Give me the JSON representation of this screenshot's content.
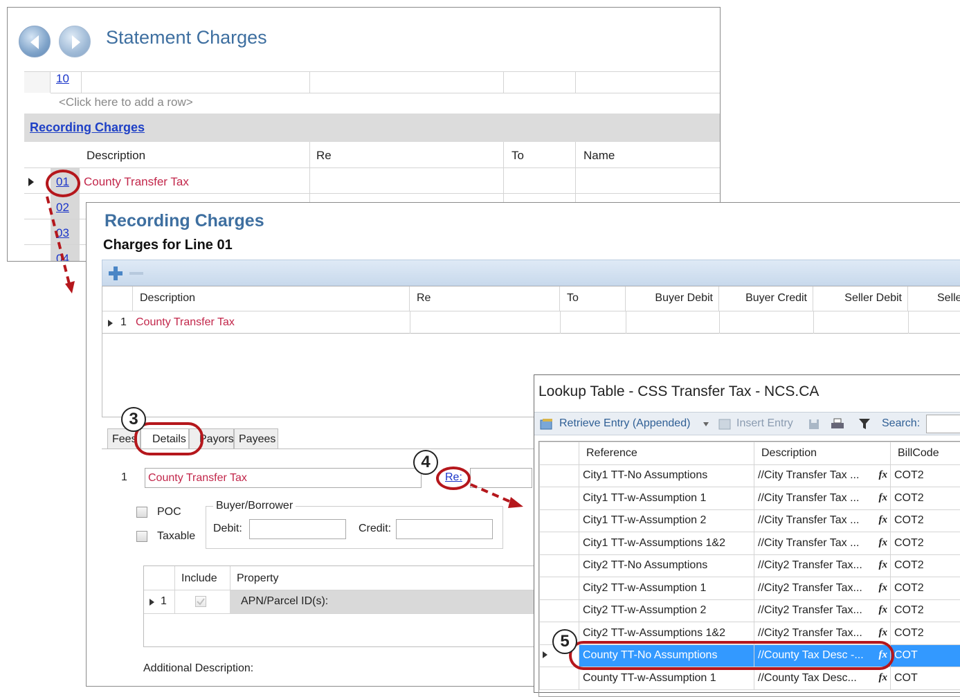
{
  "window1": {
    "title": "Statement Charges",
    "row_10": "10",
    "add_row": "<Click here to add a row>",
    "section_link": "Recording Charges",
    "headers": [
      "Description",
      "Re",
      "To",
      "Name"
    ],
    "rows": [
      {
        "num": "01",
        "desc": "County Transfer Tax"
      },
      {
        "num": "02",
        "desc": ""
      },
      {
        "num": "03",
        "desc": ""
      },
      {
        "num": "04",
        "desc": ""
      }
    ]
  },
  "window2": {
    "title": "Recording Charges",
    "subtitle": "Charges for Line 01",
    "headers": [
      "Description",
      "Re",
      "To",
      "Buyer Debit",
      "Buyer Credit",
      "Seller Debit",
      "Selle"
    ],
    "row": {
      "num": "1",
      "desc": "County Transfer Tax"
    },
    "tabs": [
      "Fees",
      "Details",
      "Payors",
      "Payees"
    ],
    "details": {
      "line_num": "1",
      "description": "County Transfer Tax",
      "re_link": "Re:",
      "poc_label": "POC",
      "taxable_label": "Taxable",
      "group_label": "Buyer/Borrower",
      "debit_label": "Debit:",
      "credit_label": "Credit:",
      "prop_headers": [
        "Include",
        "Property"
      ],
      "prop_row": {
        "num": "1",
        "property": "APN/Parcel ID(s):"
      },
      "additional_label": "Additional Description:"
    }
  },
  "window3": {
    "title": "Lookup Table - CSS Transfer Tax - NCS.CA",
    "toolbar": {
      "retrieve": "Retrieve Entry (Appended)",
      "insert": "Insert Entry",
      "search": "Search:"
    },
    "headers": [
      "Reference",
      "Description",
      "BillCode"
    ],
    "rows": [
      {
        "ref": "City1 TT-No Assumptions",
        "desc": "//City Transfer Tax ...",
        "code": "COT2"
      },
      {
        "ref": "City1 TT-w-Assumption 1",
        "desc": "//City Transfer Tax ...",
        "code": "COT2"
      },
      {
        "ref": "City1 TT-w-Assumption 2",
        "desc": "//City Transfer Tax ...",
        "code": "COT2"
      },
      {
        "ref": "City1 TT-w-Assumptions 1&2",
        "desc": "//City Transfer Tax ...",
        "code": "COT2"
      },
      {
        "ref": "City2 TT-No Assumptions",
        "desc": "//City2 Transfer Tax...",
        "code": "COT2"
      },
      {
        "ref": "City2 TT-w-Assumption 1",
        "desc": "//City2 Transfer Tax...",
        "code": "COT2"
      },
      {
        "ref": "City2 TT-w-Assumption 2",
        "desc": "//City2 Transfer Tax...",
        "code": "COT2"
      },
      {
        "ref": "City2 TT-w-Assumptions 1&2",
        "desc": "//City2 Transfer Tax...",
        "code": "COT2"
      },
      {
        "ref": "County TT-No Assumptions",
        "desc": "//County Tax Desc -...",
        "code": "COT"
      },
      {
        "ref": "County TT-w-Assumption 1",
        "desc": "//County Tax Desc...",
        "code": "COT"
      }
    ]
  },
  "callouts": [
    "3",
    "4",
    "5"
  ],
  "colors": {
    "accent_blue": "#3e6fa0",
    "charge_pink": "#c2264a",
    "callout_red": "#b5171c",
    "selected_row": "#3399ff"
  }
}
